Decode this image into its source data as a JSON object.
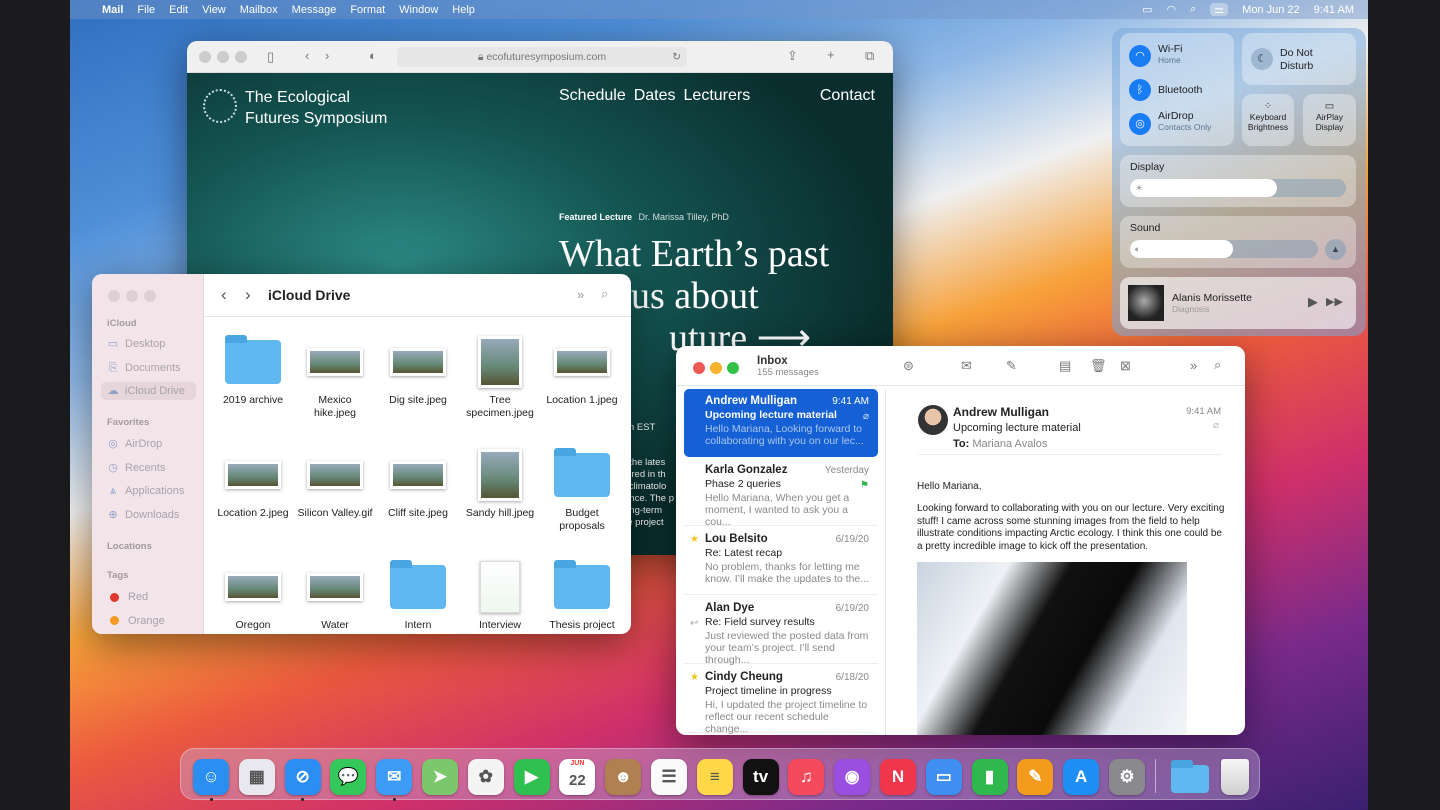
{
  "menubar": {
    "app": "Mail",
    "items": [
      "File",
      "Edit",
      "View",
      "Mailbox",
      "Message",
      "Format",
      "Window",
      "Help"
    ],
    "date": "Mon Jun 22",
    "time": "9:41 AM",
    "icons": [
      "battery-icon",
      "wifi-icon",
      "search-icon",
      "control-center-icon"
    ]
  },
  "safari": {
    "url": "ecofuturesymposium.com",
    "site_title_1": "The Ecological",
    "site_title_2": "Futures Symposium",
    "nav": [
      "Schedule",
      "Dates",
      "Lecturers",
      "Contact"
    ],
    "featured_label": "Featured Lecture",
    "featured_speaker": "Dr. Marissa Tilley, PhD",
    "headline_1": "What Earth’s past",
    "headline_2": "us about",
    "headline_3": "uture",
    "arrow": "⟶",
    "time_fragment": "om EST",
    "body_fragments": [
      "f the lates",
      "lored in th",
      "l climatolo",
      "ence. The p",
      "ong-term",
      "re project"
    ]
  },
  "finder": {
    "title": "iCloud Drive",
    "sidebar": {
      "icloud_header": "iCloud",
      "icloud": [
        "Desktop",
        "Documents",
        "iCloud Drive"
      ],
      "favorites_header": "Favorites",
      "favorites": [
        "AirDrop",
        "Recents",
        "Applications",
        "Downloads"
      ],
      "locations_header": "Locations",
      "tags_header": "Tags",
      "tags": [
        {
          "label": "Red",
          "color": "#e0392b"
        },
        {
          "label": "Orange",
          "color": "#f39a1e"
        }
      ]
    },
    "files": [
      {
        "name": "2019 archive",
        "kind": "folder"
      },
      {
        "name": "Mexico hike.jpeg",
        "kind": "image"
      },
      {
        "name": "Dig site.jpeg",
        "kind": "image"
      },
      {
        "name": "Tree specimen.jpeg",
        "kind": "image"
      },
      {
        "name": "Location 1.jpeg",
        "kind": "image"
      },
      {
        "name": "Location 2.jpeg",
        "kind": "image"
      },
      {
        "name": "Silicon Valley.gif",
        "kind": "image"
      },
      {
        "name": "Cliff site.jpeg",
        "kind": "image"
      },
      {
        "name": "Sandy hill.jpeg",
        "kind": "image"
      },
      {
        "name": "Budget proposals",
        "kind": "folder"
      },
      {
        "name": "Oregon",
        "kind": "image"
      },
      {
        "name": "Water",
        "kind": "image"
      },
      {
        "name": "Intern",
        "kind": "folder"
      },
      {
        "name": "Interview",
        "kind": "document"
      },
      {
        "name": "Thesis project",
        "kind": "folder"
      }
    ]
  },
  "mail": {
    "mailbox": "Inbox",
    "count": "155 messages",
    "messages": [
      {
        "from": "Andrew Mulligan",
        "date": "9:41 AM",
        "subject": "Upcoming lecture material",
        "preview": "Hello Mariana, Looking forward to collaborating with you on our lec...",
        "mark": "attachment",
        "selected": true
      },
      {
        "from": "Karla Gonzalez",
        "date": "Yesterday",
        "subject": "Phase 2 queries",
        "preview": "Hello Mariana, When you get a moment, I wanted to ask you a cou...",
        "mark": "flag"
      },
      {
        "from": "Lou Belsito",
        "date": "6/19/20",
        "subject": "Re: Latest recap",
        "preview": "No problem, thanks for letting me know. I’ll make the updates to the...",
        "mark": "star"
      },
      {
        "from": "Alan Dye",
        "date": "6/19/20",
        "subject": "Re: Field survey results",
        "preview": "Just reviewed the posted data from your team’s project. I’ll send through...",
        "mark": "replied"
      },
      {
        "from": "Cindy Cheung",
        "date": "6/18/20",
        "subject": "Project timeline in progress",
        "preview": "Hi, I updated the project timeline to reflect our recent schedule change...",
        "mark": "star"
      }
    ],
    "reader": {
      "from": "Andrew Mulligan",
      "subject": "Upcoming lecture material",
      "to_label": "To:",
      "to": "Mariana Avalos",
      "time": "9:41 AM",
      "greeting": "Hello Mariana,",
      "body": "Looking forward to collaborating with you on our lecture. Very exciting stuff! I came across some stunning images from the field to help illustrate conditions impacting Arctic ecology. I think this one could be a pretty incredible image to kick off the presentation."
    }
  },
  "control_center": {
    "wifi": "Wi-Fi",
    "wifi_sub": "Home",
    "bluetooth": "Bluetooth",
    "airdrop": "AirDrop",
    "airdrop_sub": "Contacts Only",
    "dnd_1": "Do Not",
    "dnd_2": "Disturb",
    "kb_1": "Keyboard",
    "kb_2": "Brightness",
    "airplay_1": "AirPlay",
    "airplay_2": "Display",
    "display": "Display",
    "display_level": 0.68,
    "sound": "Sound",
    "sound_level": 0.55,
    "artist": "Alanis Morissette",
    "track": "Diagnosis"
  },
  "dock": {
    "apps": [
      {
        "name": "finder",
        "color": "#2a8ff0",
        "glyph": "☺",
        "running": true
      },
      {
        "name": "launchpad",
        "color": "#e8e8ee",
        "glyph": "▦"
      },
      {
        "name": "safari",
        "color": "#2c8ef2",
        "glyph": "⊘",
        "running": true
      },
      {
        "name": "messages",
        "color": "#34c759",
        "glyph": "💬"
      },
      {
        "name": "mail",
        "color": "#3b9bf6",
        "glyph": "✉",
        "running": true
      },
      {
        "name": "maps",
        "color": "#7cc66c",
        "glyph": "➤"
      },
      {
        "name": "photos",
        "color": "#f4f4f4",
        "glyph": "✿"
      },
      {
        "name": "facetime",
        "color": "#30c04f",
        "glyph": "▶"
      },
      {
        "name": "calendar",
        "color": "#ffffff",
        "glyph": "22",
        "label": "JUN"
      },
      {
        "name": "contacts",
        "color": "#b08050",
        "glyph": "☻"
      },
      {
        "name": "reminders",
        "color": "#fafafa",
        "glyph": "☰"
      },
      {
        "name": "notes",
        "color": "#ffd84a",
        "glyph": "≡"
      },
      {
        "name": "tv",
        "color": "#111111",
        "glyph": "tv"
      },
      {
        "name": "music",
        "color": "#f44a5c",
        "glyph": "♫"
      },
      {
        "name": "podcasts",
        "color": "#9b4fe0",
        "glyph": "◉"
      },
      {
        "name": "news",
        "color": "#f0364a",
        "glyph": "N"
      },
      {
        "name": "keynote",
        "color": "#3f8ff2",
        "glyph": "▭"
      },
      {
        "name": "numbers",
        "color": "#2fb84e",
        "glyph": "▮"
      },
      {
        "name": "pages",
        "color": "#f29b1d",
        "glyph": "✎"
      },
      {
        "name": "app-store",
        "color": "#1e8ef5",
        "glyph": "A"
      },
      {
        "name": "system-preferences",
        "color": "#8a8a8e",
        "glyph": "⚙"
      }
    ],
    "folder": "downloads",
    "trash": "trash"
  }
}
